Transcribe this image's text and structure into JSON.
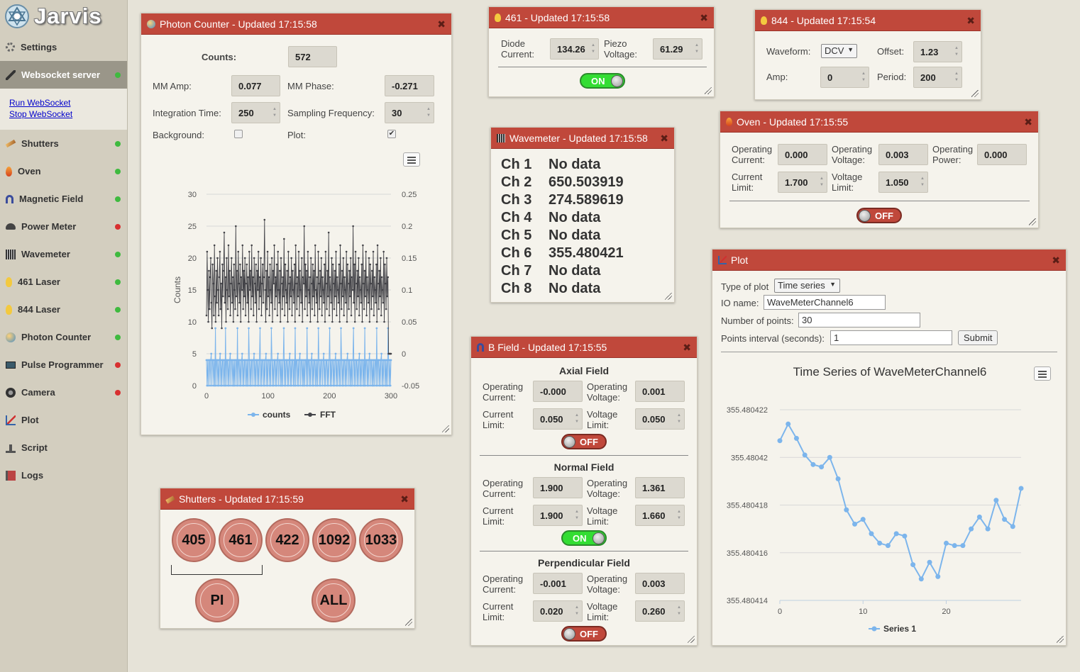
{
  "app": {
    "title": "Jarvis"
  },
  "sidebar": {
    "items": [
      {
        "label": "Settings",
        "status": ""
      },
      {
        "label": "Websocket server",
        "status": "green"
      },
      {
        "label": "Shutters",
        "status": "green"
      },
      {
        "label": "Oven",
        "status": "green"
      },
      {
        "label": "Magnetic Field",
        "status": "green"
      },
      {
        "label": "Power Meter",
        "status": "red"
      },
      {
        "label": "Wavemeter",
        "status": "green"
      },
      {
        "label": "461 Laser",
        "status": "green"
      },
      {
        "label": "844 Laser",
        "status": "green"
      },
      {
        "label": "Photon Counter",
        "status": "green"
      },
      {
        "label": "Pulse Programmer",
        "status": "red"
      },
      {
        "label": "Camera",
        "status": "red"
      },
      {
        "label": "Plot",
        "status": ""
      },
      {
        "label": "Script",
        "status": ""
      },
      {
        "label": "Logs",
        "status": ""
      }
    ],
    "ws_links": {
      "run": "Run WebSocket",
      "stop": "Stop WebSocket"
    }
  },
  "photon": {
    "title": "Photon Counter - Updated 17:15:58",
    "counts_label": "Counts:",
    "counts": "572",
    "mm_amp_label": "MM Amp:",
    "mm_amp": "0.077",
    "mm_phase_label": "MM Phase:",
    "mm_phase": "-0.271",
    "int_time_label": "Integration Time:",
    "int_time": "250",
    "samp_freq_label": "Sampling Frequency:",
    "samp_freq": "30",
    "background_label": "Background:",
    "background_checked": false,
    "plot_label": "Plot:",
    "plot_checked": true
  },
  "laser461": {
    "title": "461 - Updated 17:15:58",
    "diode_label_1": "Diode",
    "diode_label_2": "Current:",
    "diode_current": "134.26",
    "piezo_label_1": "Piezo",
    "piezo_label_2": "Voltage:",
    "piezo_voltage": "61.29",
    "toggle": "ON"
  },
  "laser844": {
    "title": "844 - Updated 17:15:54",
    "waveform_label": "Waveform:",
    "waveform": "DCV",
    "offset_label": "Offset:",
    "offset": "1.23",
    "amp_label": "Amp:",
    "amp": "0",
    "period_label": "Period:",
    "period": "200"
  },
  "oven": {
    "title": "Oven - Updated 17:15:55",
    "op_current_l1": "Operating",
    "op_current_l2": "Current:",
    "op_current": "0.000",
    "op_voltage_l1": "Operating",
    "op_voltage_l2": "Voltage:",
    "op_voltage": "0.003",
    "op_power_l1": "Operating",
    "op_power_l2": "Power:",
    "op_power": "0.000",
    "cur_limit_l1": "Current",
    "cur_limit_l2": "Limit:",
    "cur_limit": "1.700",
    "volt_limit_l1": "Voltage",
    "volt_limit_l2": "Limit:",
    "volt_limit": "1.050",
    "toggle": "OFF"
  },
  "wavemeter": {
    "title": "Wavemeter - Updated 17:15:58",
    "channels": [
      {
        "ch": "Ch 1",
        "value": "No data"
      },
      {
        "ch": "Ch 2",
        "value": "650.503919"
      },
      {
        "ch": "Ch 3",
        "value": "274.589619"
      },
      {
        "ch": "Ch 4",
        "value": "No data"
      },
      {
        "ch": "Ch 5",
        "value": "No data"
      },
      {
        "ch": "Ch 6",
        "value": "355.480421"
      },
      {
        "ch": "Ch 7",
        "value": "No data"
      },
      {
        "ch": "Ch 8",
        "value": "No data"
      }
    ]
  },
  "bfield": {
    "title": "B Field - Updated 17:15:55",
    "lbl_operating": "Operating",
    "lbl_current": "Current:",
    "lbl_voltage": "Voltage:",
    "lbl_current_limit": "Current",
    "lbl_voltage_limit": "Voltage",
    "lbl_limit": "Limit:",
    "sections": [
      {
        "name": "Axial Field",
        "op_current": "-0.000",
        "op_voltage": "0.001",
        "cur_limit": "0.050",
        "volt_limit": "0.050",
        "toggle": "OFF"
      },
      {
        "name": "Normal Field",
        "op_current": "1.900",
        "op_voltage": "1.361",
        "cur_limit": "1.900",
        "volt_limit": "1.660",
        "toggle": "ON"
      },
      {
        "name": "Perpendicular Field",
        "op_current": "-0.001",
        "op_voltage": "0.003",
        "cur_limit": "0.020",
        "volt_limit": "0.260",
        "toggle": "OFF"
      }
    ]
  },
  "shutters": {
    "title": "Shutters - Updated 17:15:59",
    "buttons": [
      "405",
      "461",
      "422",
      "1092",
      "1033"
    ],
    "pi": "PI",
    "all": "ALL"
  },
  "plotpanel": {
    "title": "Plot",
    "type_label": "Type of plot",
    "type_value": "Time series",
    "io_label": "IO name:",
    "io_value": "WaveMeterChannel6",
    "npoints_label": "Number of points:",
    "npoints_value": "30",
    "interval_label": "Points interval (seconds):",
    "interval_value": "1",
    "submit": "Submit"
  },
  "chart_data": [
    {
      "type": "line",
      "title": "",
      "ylabel": "Counts",
      "y_ticks": [
        "30",
        "25",
        "20",
        "15",
        "10",
        "5",
        "0"
      ],
      "y2_ticks": [
        "0.25",
        "0.2",
        "0.15",
        "0.1",
        "0.05",
        "0",
        "-0.05"
      ],
      "x_ticks": [
        "0",
        "100",
        "200",
        "300"
      ],
      "ylim": [
        0,
        30
      ],
      "y2lim": [
        -0.05,
        0.25
      ],
      "xlim": [
        0,
        300
      ],
      "series": [
        {
          "name": "counts",
          "color": "#7cb5ec",
          "values": [
            4,
            0,
            4,
            0,
            4,
            4,
            0,
            4,
            5,
            0,
            4,
            4,
            0,
            4,
            0,
            9,
            0,
            4,
            4,
            0,
            4,
            0,
            4,
            5,
            0,
            4,
            0,
            4,
            4,
            0,
            4,
            0,
            9,
            0,
            4,
            4,
            0,
            4,
            0,
            4,
            5,
            0,
            4,
            4,
            0,
            4,
            0,
            4,
            0,
            4,
            4,
            0,
            9,
            0,
            4,
            4,
            0,
            4,
            0,
            4,
            5,
            0,
            4,
            0,
            4,
            4,
            0,
            4,
            0,
            4,
            0,
            9,
            4,
            0,
            4,
            0,
            4,
            4,
            0,
            4,
            5,
            0,
            4,
            0,
            4,
            4,
            0,
            4,
            0,
            4,
            9,
            0,
            4,
            0,
            4,
            4,
            0,
            4,
            0,
            4,
            5,
            0,
            4,
            0,
            4,
            4,
            0,
            4,
            0,
            9,
            4,
            0,
            4,
            0,
            4,
            4,
            0,
            4,
            0,
            4,
            5,
            0,
            4,
            4,
            0,
            4,
            0,
            4,
            0,
            4,
            9,
            0,
            4,
            0,
            4,
            4,
            0,
            4,
            0,
            4,
            5,
            0,
            4,
            0,
            4,
            4,
            0,
            4,
            0,
            9,
            0,
            4,
            4,
            0,
            4,
            0,
            4,
            5,
            0,
            4,
            4,
            0,
            4,
            0,
            4,
            0,
            4,
            4,
            0,
            9,
            0,
            4,
            4,
            0,
            4,
            0,
            4,
            5,
            0,
            4,
            0,
            4,
            4,
            0,
            4,
            0,
            4,
            0,
            9,
            4,
            0,
            4,
            0,
            4,
            4,
            0,
            4,
            5,
            0,
            4,
            0,
            4,
            4,
            0,
            4,
            0,
            4,
            9,
            0,
            4,
            0,
            4,
            4,
            0,
            4,
            0,
            4,
            5,
            0,
            4,
            0,
            4,
            4,
            0,
            4,
            0,
            9,
            4,
            0,
            4,
            0,
            4,
            4,
            0,
            4,
            0,
            4,
            5,
            0,
            4,
            4,
            0,
            4,
            0,
            4,
            0,
            4,
            9,
            0,
            4,
            0,
            4,
            4,
            0,
            4,
            0,
            4,
            5,
            0,
            4,
            0,
            4,
            4,
            0,
            4,
            0,
            9,
            0,
            4,
            4,
            0,
            4,
            0,
            4,
            5,
            0,
            4,
            4,
            0,
            4,
            0,
            4,
            0,
            4,
            4,
            0,
            9,
            0,
            4,
            4,
            0,
            4,
            0,
            4,
            5,
            0,
            4,
            0,
            4,
            4,
            0,
            4,
            0,
            4,
            0,
            9,
            4,
            0,
            4,
            0,
            4
          ]
        },
        {
          "name": "FFT",
          "color": "#434348",
          "values": [
            0.06,
            0.16,
            0.1,
            0.05,
            0.13,
            0.07,
            0.12,
            0.15,
            0.08,
            0.04,
            0.14,
            0.11,
            0.06,
            0.17,
            0.09,
            0.05,
            0.13,
            0.08,
            0.15,
            0.1,
            0.06,
            0.12,
            0.16,
            0.07,
            0.11,
            0.04,
            0.14,
            0.09,
            0.13,
            0.19,
            0.08,
            0.12,
            0.05,
            0.15,
            0.1,
            0.07,
            0.17,
            0.09,
            0.13,
            0.06,
            0.11,
            0.15,
            0.08,
            0.12,
            0.05,
            0.14,
            0.1,
            0.07,
            0.2,
            0.09,
            0.13,
            0.06,
            0.16,
            0.11,
            0.08,
            0.14,
            0.05,
            0.12,
            0.1,
            0.17,
            0.07,
            0.13,
            0.09,
            0.15,
            0.06,
            0.11,
            0.14,
            0.08,
            0.12,
            0.05,
            0.16,
            0.1,
            0.13,
            0.07,
            0.17,
            0.09,
            0.12,
            0.06,
            0.15,
            0.11,
            0.08,
            0.14,
            0.05,
            0.13,
            0.1,
            0.16,
            0.07,
            0.12,
            0.09,
            0.15,
            0.06,
            0.11,
            0.14,
            0.08,
            0.12,
            0.21,
            0.1,
            0.05,
            0.13,
            0.07,
            0.16,
            0.09,
            0.12,
            0.06,
            0.14,
            0.1,
            0.08,
            0.15,
            0.05,
            0.13,
            0.11,
            0.17,
            0.07,
            0.12,
            0.09,
            0.14,
            0.06,
            0.16,
            0.1,
            0.08,
            0.13,
            0.05,
            0.15,
            0.11,
            0.07,
            0.12,
            0.09,
            0.18,
            0.06,
            0.14,
            0.1,
            0.08,
            0.13,
            0.05,
            0.16,
            0.11,
            0.07,
            0.12,
            0.09,
            0.15,
            0.06,
            0.13,
            0.1,
            0.08,
            0.14,
            0.05,
            0.17,
            0.11,
            0.07,
            0.12,
            0.09,
            0.16,
            0.06,
            0.13,
            0.1,
            0.08,
            0.15,
            0.05,
            0.12,
            0.11,
            0.2,
            0.07,
            0.14,
            0.09,
            0.13,
            0.06,
            0.16,
            0.1,
            0.08,
            0.12,
            0.05,
            0.15,
            0.11,
            0.07,
            0.14,
            0.09,
            0.13,
            0.06,
            0.17,
            0.1,
            0.08,
            0.12,
            0.05,
            0.16,
            0.11,
            0.07,
            0.13,
            0.09,
            0.15,
            0.06,
            0.12,
            0.1,
            0.08,
            0.14,
            0.05,
            0.16,
            0.11,
            0.07,
            0.13,
            0.09,
            0.19,
            0.06,
            0.12,
            0.1,
            0.08,
            0.15,
            0.05,
            0.14,
            0.11,
            0.07,
            0.13,
            0.09,
            0.16,
            0.06,
            0.12,
            0.1,
            0.08,
            0.14,
            0.05,
            0.17,
            0.11,
            0.07,
            0.13,
            0.09,
            0.15,
            0.06,
            0.12,
            0.1,
            0.08,
            0.16,
            0.05,
            0.14,
            0.11,
            0.07,
            0.13,
            0.09,
            0.15,
            0.06,
            0.12,
            0.1,
            0.2,
            0.08,
            0.14,
            0.05,
            0.16,
            0.11,
            0.07,
            0.13,
            0.09,
            0.15,
            0.06,
            0.12,
            0.1,
            0.08,
            0.14,
            0.05,
            0.17,
            0.11,
            0.07,
            0.13,
            0.09,
            0.16,
            0.06,
            0.12,
            0.1,
            0.08,
            0.15,
            0.05,
            0.14,
            0.11,
            0.07,
            0.13,
            0.09,
            0.16,
            0.06,
            0.12,
            0.1,
            0.08,
            0.14,
            0.05,
            0.17,
            0.11,
            0.07,
            0.13,
            0.09,
            0.15,
            0.06,
            0.12,
            0.1,
            0.08,
            0.16,
            0.05,
            0.14,
            0.11,
            0.07,
            0.15,
            0.09,
            0.12,
            0.0,
            0.0,
            0.0,
            0.0,
            0.0
          ]
        }
      ]
    },
    {
      "type": "line",
      "title": "Time Series of WaveMeterChannel6",
      "y_ticks": [
        "355.480422",
        "355.48042",
        "355.480418",
        "355.480416",
        "355.480414"
      ],
      "x_ticks": [
        "0",
        "10",
        "20"
      ],
      "ylim": [
        355.480414,
        355.480422
      ],
      "xlim": [
        0,
        29
      ],
      "series": [
        {
          "name": "Series 1",
          "color": "#7cb5ec",
          "values": [
            355.4804207,
            355.4804214,
            355.4804208,
            355.4804201,
            355.4804197,
            355.4804196,
            355.48042,
            355.4804191,
            355.4804178,
            355.4804172,
            355.4804174,
            355.4804168,
            355.4804164,
            355.4804163,
            355.4804168,
            355.4804167,
            355.4804155,
            355.4804149,
            355.4804156,
            355.480415,
            355.4804164,
            355.4804163,
            355.4804163,
            355.480417,
            355.4804175,
            355.480417,
            355.4804182,
            355.4804174,
            355.4804171,
            355.4804187
          ]
        }
      ]
    }
  ]
}
